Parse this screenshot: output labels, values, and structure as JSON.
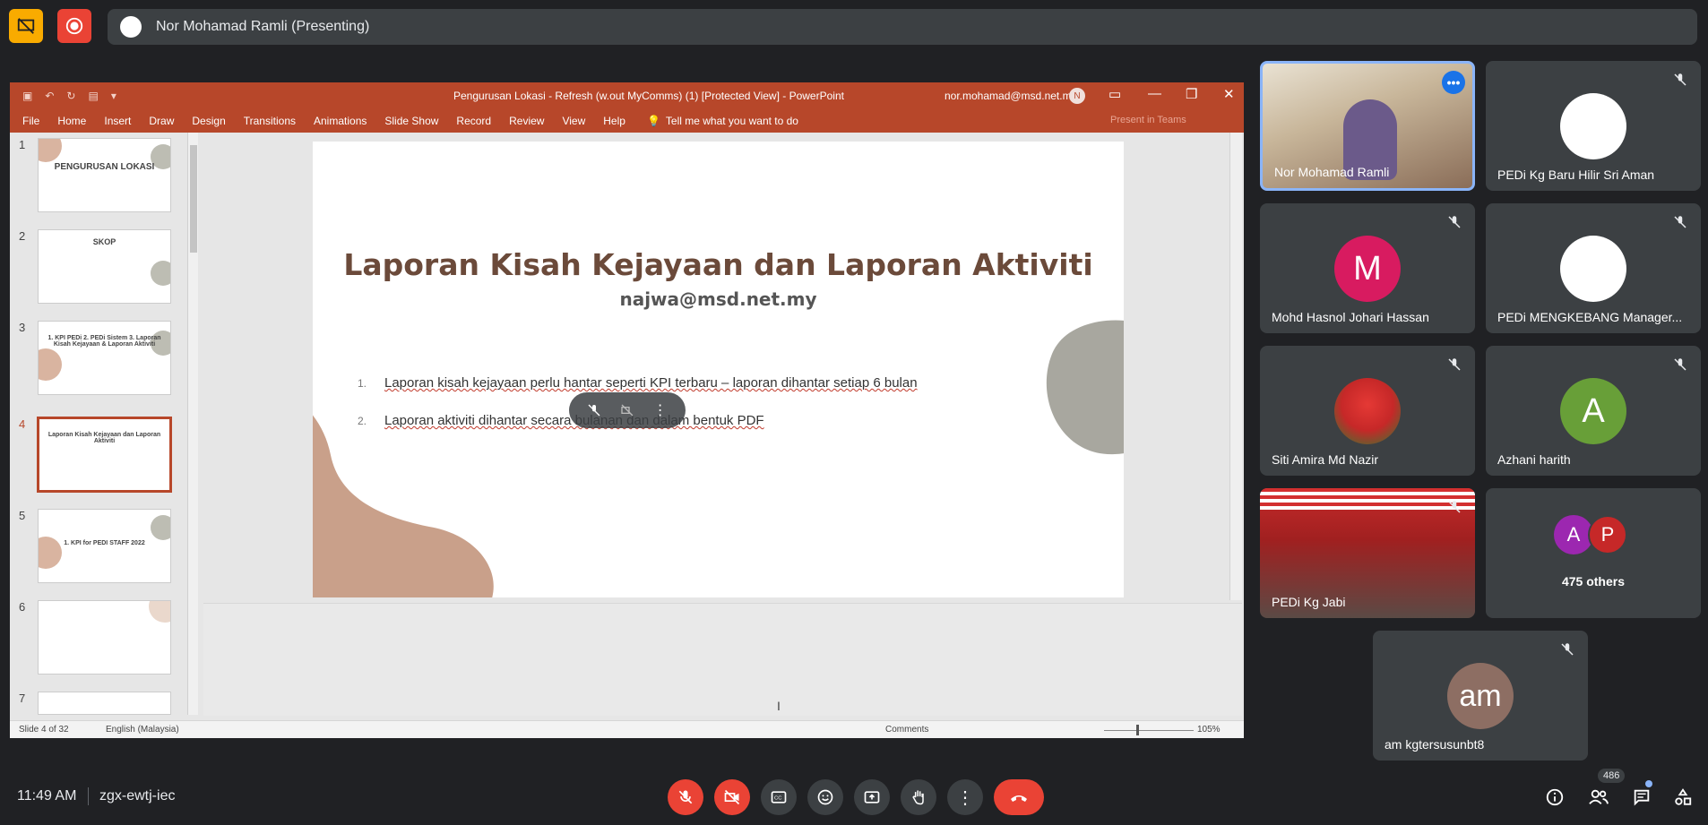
{
  "meet": {
    "presenter_banner": "Nor Mohamad Ramli (Presenting)",
    "time": "11:49 AM",
    "meeting_code": "zgx-ewtj-iec",
    "participant_count": "486",
    "others_label": "475 others",
    "others_avatars": [
      "A",
      "P"
    ]
  },
  "powerpoint": {
    "title": "Pengurusan Lokasi - Refresh (w.out MyComms) (1) [Protected View]  -  PowerPoint",
    "user": "nor.mohamad@msd.net.my",
    "user_initial": "N",
    "ribbon_tabs": [
      "File",
      "Home",
      "Insert",
      "Draw",
      "Design",
      "Transitions",
      "Animations",
      "Slide Show",
      "Record",
      "Review",
      "View",
      "Help"
    ],
    "tell_me": "Tell me what you want to do",
    "present_in_teams": "Present in Teams",
    "thumbnails": [
      {
        "num": "1",
        "text": "PENGURUSAN LOKASI"
      },
      {
        "num": "2",
        "text": "SKOP"
      },
      {
        "num": "3",
        "text": "1. KPI PEDi  2. PEDi Sistem  3. Laporan Kisah Kejayaan & Laporan Aktiviti"
      },
      {
        "num": "4",
        "text": "Laporan Kisah Kejayaan dan Laporan Aktiviti"
      },
      {
        "num": "5",
        "text": "1. KPI for PEDI STAFF 2022"
      },
      {
        "num": "6",
        "text": ""
      },
      {
        "num": "7",
        "text": ""
      }
    ],
    "slide": {
      "title": "Laporan Kisah Kejayaan dan Laporan Aktiviti",
      "subtitle": "najwa@msd.net.my",
      "bullets": [
        {
          "n": "1.",
          "text": "Laporan kisah kejayaan perlu hantar seperti KPI terbaru – laporan dihantar setiap 6 bulan"
        },
        {
          "n": "2.",
          "text": "Laporan aktiviti dihantar secara bulanan dan dalam bentuk PDF"
        }
      ]
    },
    "status": {
      "slide_of": "Slide 4 of 32",
      "language": "English (Malaysia)",
      "comments": "Comments",
      "zoom": "105%"
    }
  },
  "participants": [
    {
      "name": "Nor Mohamad Ramli",
      "type": "video-1"
    },
    {
      "name": "PEDi Kg Baru Hilir Sri Aman",
      "type": "logo"
    },
    {
      "name": "Mohd Hasnol Johari Hassan",
      "type": "letter",
      "letter": "M",
      "color": "#d81b60"
    },
    {
      "name": "PEDi MENGKEBANG Manager...",
      "type": "logo"
    },
    {
      "name": "Siti Amira Md Nazir",
      "type": "tulip"
    },
    {
      "name": "Azhani harith",
      "type": "letter",
      "letter": "A",
      "color": "#689f38"
    },
    {
      "name": "PEDi Kg Jabi",
      "type": "video-2"
    },
    {
      "name": "am kgtersusunbt8",
      "type": "letter",
      "letter": "am",
      "color": "#8d6e63"
    }
  ]
}
